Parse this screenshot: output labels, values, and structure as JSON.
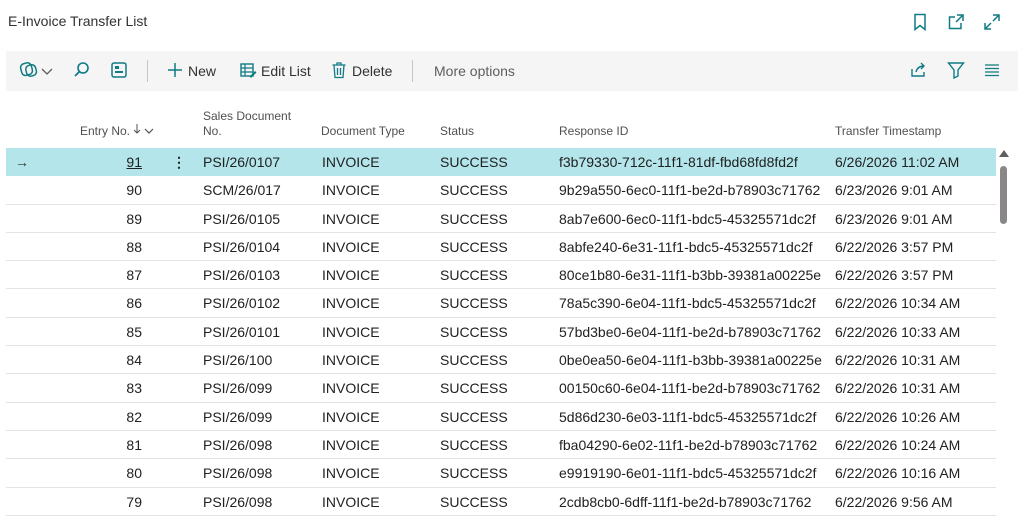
{
  "page": {
    "title": "E-Invoice Transfer List"
  },
  "title_icons": [
    "bookmark-icon",
    "open-in-new-window-icon",
    "expand-icon"
  ],
  "actions": {
    "new_label": "New",
    "edit_list_label": "Edit List",
    "delete_label": "Delete",
    "more_options_label": "More options"
  },
  "columns": {
    "entry_no": "Entry No.",
    "sales_doc_line1": "Sales Document",
    "sales_doc_line2": "No.",
    "document_type": "Document Type",
    "status": "Status",
    "response_id": "Response ID",
    "transfer_timestamp": "Transfer Timestamp"
  },
  "selected_row_marker": "→",
  "rows": [
    {
      "entry_no": "91",
      "doc_no": "PSI/26/0107",
      "type": "INVOICE",
      "status": "SUCCESS",
      "response_id": "f3b79330-712c-11f1-81df-fbd68fd8fd2f",
      "timestamp": "6/26/2026 11:02 AM"
    },
    {
      "entry_no": "90",
      "doc_no": "SCM/26/017",
      "type": "INVOICE",
      "status": "SUCCESS",
      "response_id": "9b29a550-6ec0-11f1-be2d-b78903c71762",
      "timestamp": "6/23/2026 9:01 AM"
    },
    {
      "entry_no": "89",
      "doc_no": "PSI/26/0105",
      "type": "INVOICE",
      "status": "SUCCESS",
      "response_id": "8ab7e600-6ec0-11f1-bdc5-45325571dc2f",
      "timestamp": "6/23/2026 9:01 AM"
    },
    {
      "entry_no": "88",
      "doc_no": "PSI/26/0104",
      "type": "INVOICE",
      "status": "SUCCESS",
      "response_id": "8abfe240-6e31-11f1-bdc5-45325571dc2f",
      "timestamp": "6/22/2026 3:57 PM"
    },
    {
      "entry_no": "87",
      "doc_no": "PSI/26/0103",
      "type": "INVOICE",
      "status": "SUCCESS",
      "response_id": "80ce1b80-6e31-11f1-b3bb-39381a00225e",
      "timestamp": "6/22/2026 3:57 PM"
    },
    {
      "entry_no": "86",
      "doc_no": "PSI/26/0102",
      "type": "INVOICE",
      "status": "SUCCESS",
      "response_id": "78a5c390-6e04-11f1-bdc5-45325571dc2f",
      "timestamp": "6/22/2026 10:34 AM"
    },
    {
      "entry_no": "85",
      "doc_no": "PSI/26/0101",
      "type": "INVOICE",
      "status": "SUCCESS",
      "response_id": "57bd3be0-6e04-11f1-be2d-b78903c71762",
      "timestamp": "6/22/2026 10:33 AM"
    },
    {
      "entry_no": "84",
      "doc_no": "PSI/26/100",
      "type": "INVOICE",
      "status": "SUCCESS",
      "response_id": "0be0ea50-6e04-11f1-b3bb-39381a00225e",
      "timestamp": "6/22/2026 10:31 AM"
    },
    {
      "entry_no": "83",
      "doc_no": "PSI/26/099",
      "type": "INVOICE",
      "status": "SUCCESS",
      "response_id": "00150c60-6e04-11f1-be2d-b78903c71762",
      "timestamp": "6/22/2026 10:31 AM"
    },
    {
      "entry_no": "82",
      "doc_no": "PSI/26/099",
      "type": "INVOICE",
      "status": "SUCCESS",
      "response_id": "5d86d230-6e03-11f1-bdc5-45325571dc2f",
      "timestamp": "6/22/2026 10:26 AM"
    },
    {
      "entry_no": "81",
      "doc_no": "PSI/26/098",
      "type": "INVOICE",
      "status": "SUCCESS",
      "response_id": "fba04290-6e02-11f1-be2d-b78903c71762",
      "timestamp": "6/22/2026 10:24 AM"
    },
    {
      "entry_no": "80",
      "doc_no": "PSI/26/098",
      "type": "INVOICE",
      "status": "SUCCESS",
      "response_id": "e9919190-6e01-11f1-bdc5-45325571dc2f",
      "timestamp": "6/22/2026 10:16 AM"
    },
    {
      "entry_no": "79",
      "doc_no": "PSI/26/098",
      "type": "INVOICE",
      "status": "SUCCESS",
      "response_id": "2cdb8cb0-6dff-11f1-be2d-b78903c71762",
      "timestamp": "6/22/2026 9:56 AM"
    }
  ],
  "colors": {
    "accent": "#0f7b84",
    "selected_row": "#b3e5ea",
    "action_bar": "#f5f5f5"
  }
}
